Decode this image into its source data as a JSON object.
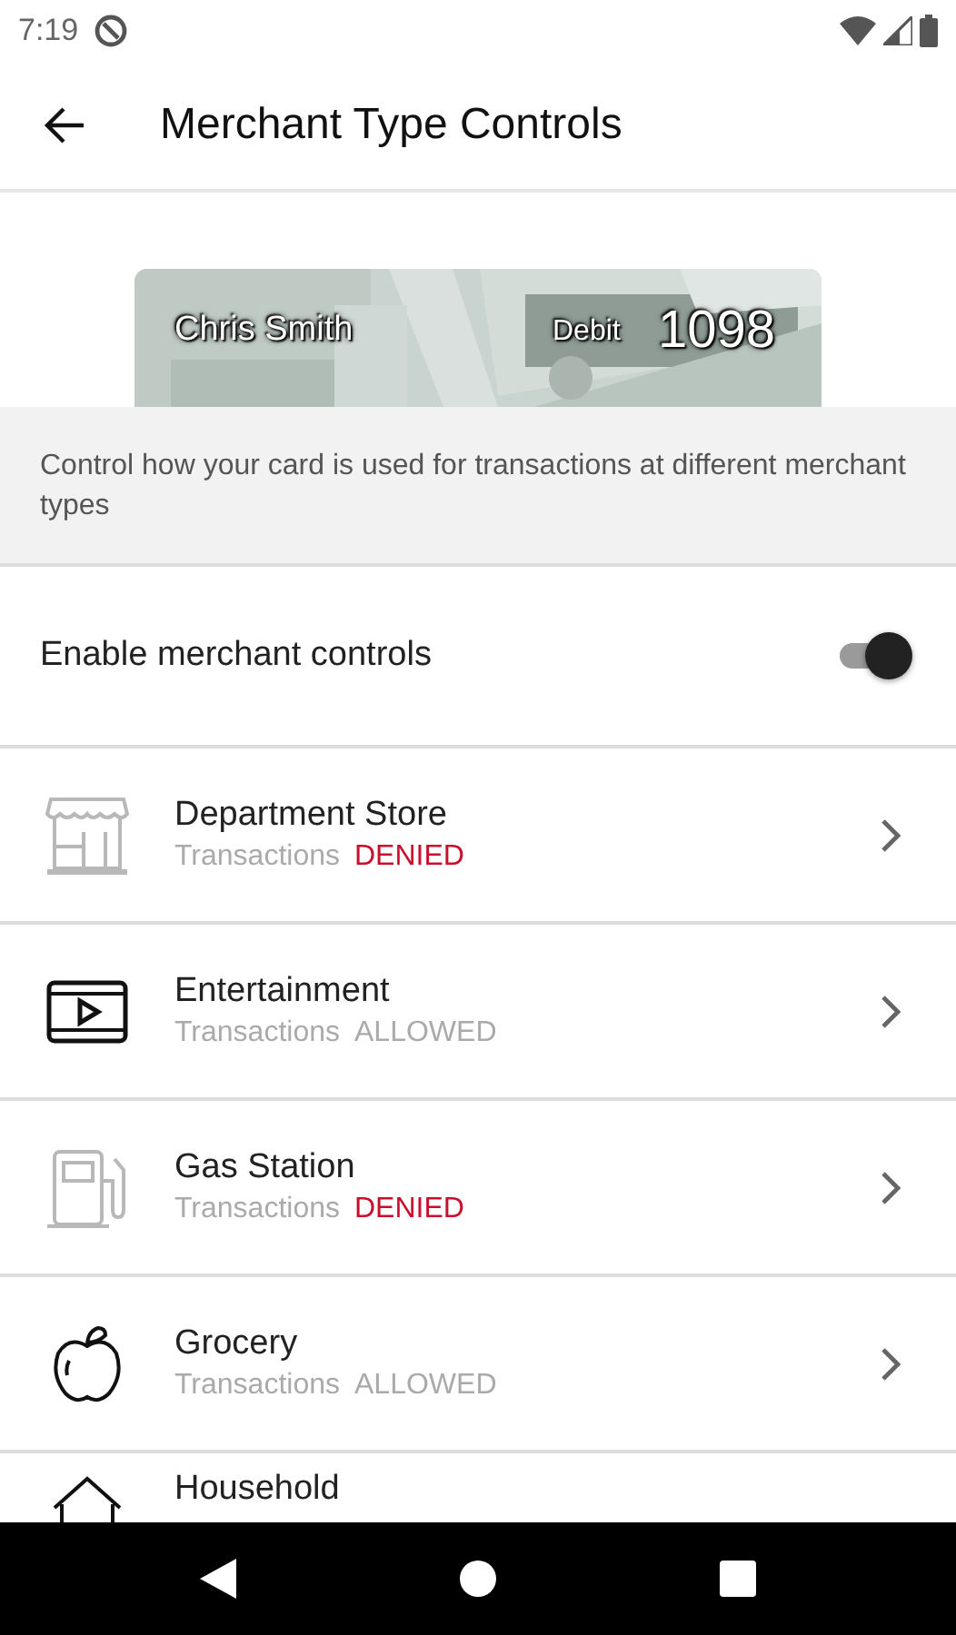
{
  "status_bar": {
    "time": "7:19"
  },
  "app_bar": {
    "title": "Merchant Type Controls"
  },
  "card": {
    "holder": "Chris Smith",
    "type": "Debit",
    "last_digits": "1098"
  },
  "info": "Control how your card is used for transactions at different merchant types",
  "enable_controls": {
    "label": "Enable merchant controls",
    "on": true
  },
  "merchants": [
    {
      "kind": "store",
      "name": "Department Store",
      "label": "Transactions",
      "status": "DENIED",
      "denied": true
    },
    {
      "kind": "film",
      "name": "Entertainment",
      "label": "Transactions",
      "status": "ALLOWED",
      "denied": false
    },
    {
      "kind": "gas",
      "name": "Gas Station",
      "label": "Transactions",
      "status": "DENIED",
      "denied": true
    },
    {
      "kind": "apple",
      "name": "Grocery",
      "label": "Transactions",
      "status": "ALLOWED",
      "denied": false
    },
    {
      "kind": "house",
      "name": "Household",
      "denied": false
    }
  ]
}
